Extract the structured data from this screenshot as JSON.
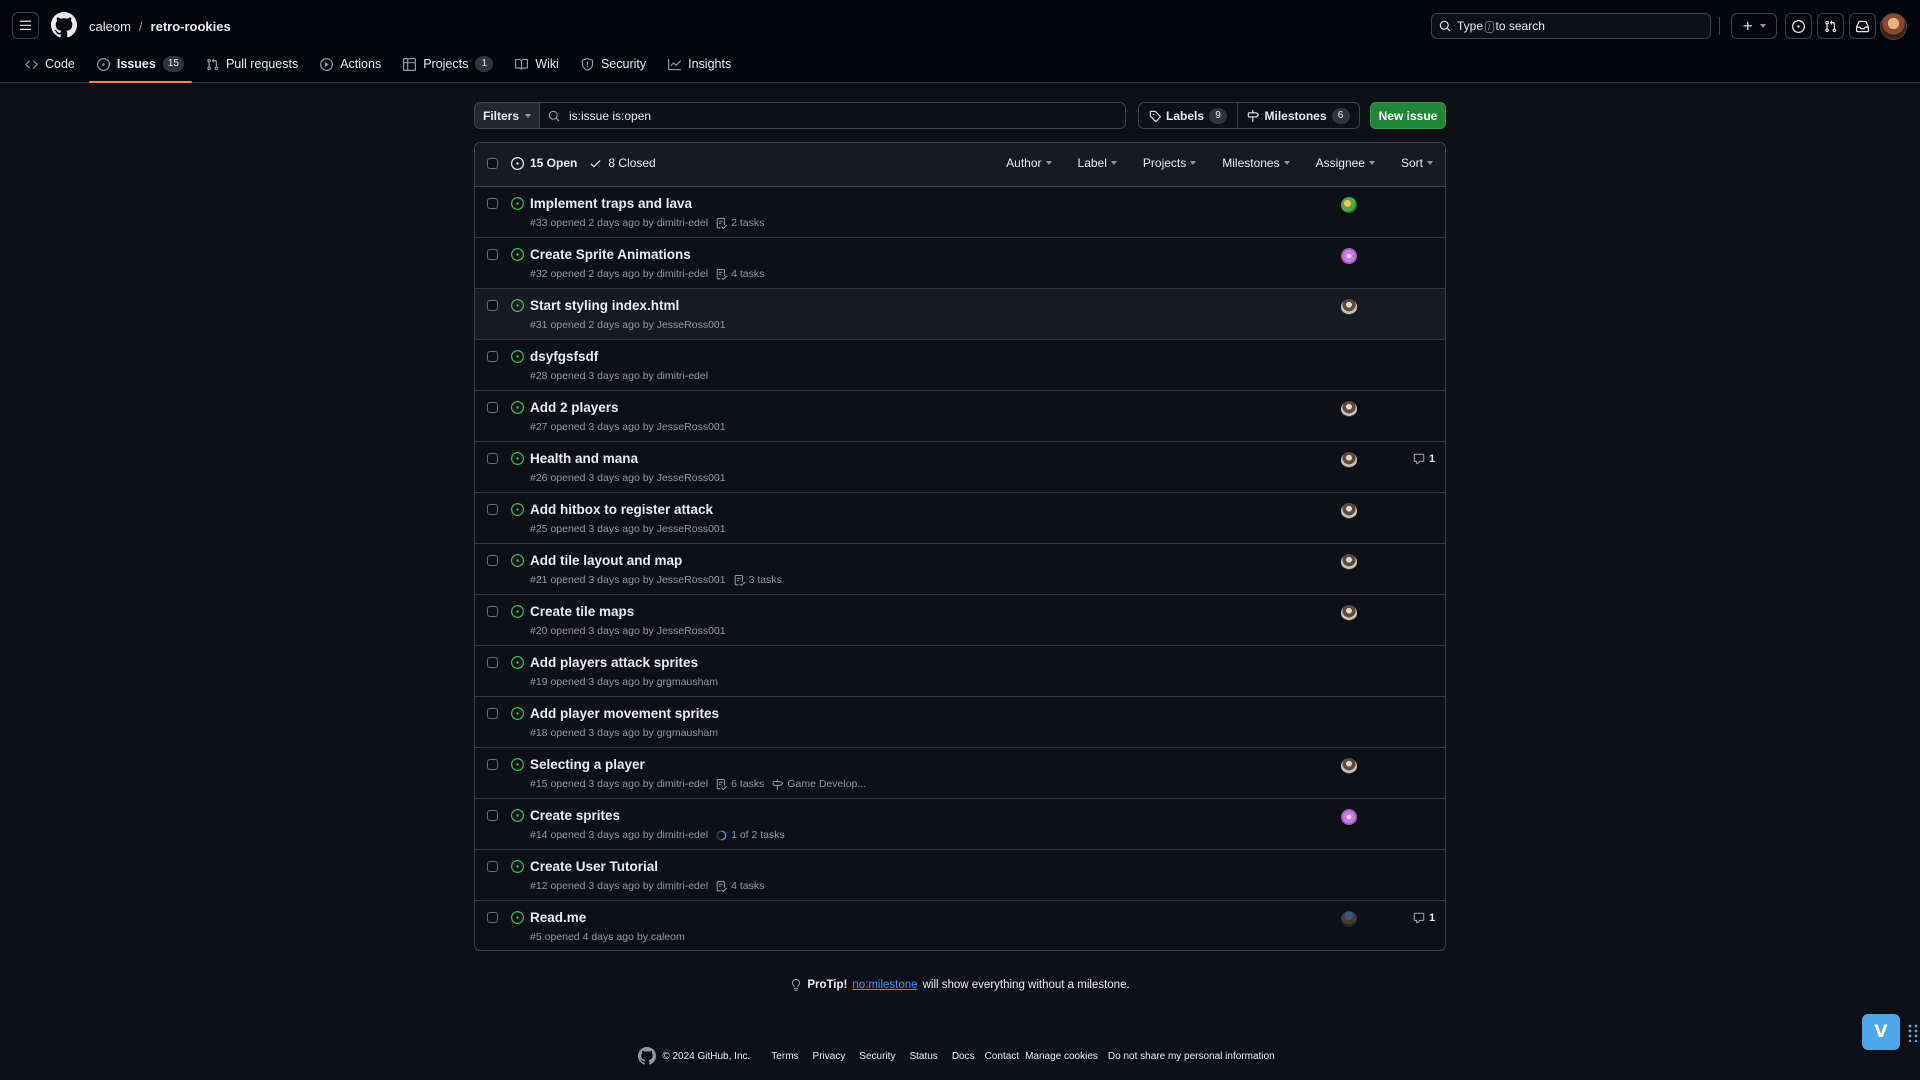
{
  "header": {
    "owner": "caleom",
    "separator": "/",
    "repo": "retro-rookies",
    "search_prefix": "Type",
    "search_key": "/",
    "search_suffix": "to search"
  },
  "repo_nav": [
    {
      "label": "Code",
      "icon": "code-icon"
    },
    {
      "label": "Issues",
      "icon": "issue-opened-icon",
      "count": "15",
      "selected": true
    },
    {
      "label": "Pull requests",
      "icon": "git-pull-request-icon"
    },
    {
      "label": "Actions",
      "icon": "play-icon"
    },
    {
      "label": "Projects",
      "icon": "table-icon",
      "count": "1"
    },
    {
      "label": "Wiki",
      "icon": "book-icon"
    },
    {
      "label": "Security",
      "icon": "shield-icon"
    },
    {
      "label": "Insights",
      "icon": "graph-icon"
    }
  ],
  "subnav": {
    "filters_label": "Filters",
    "query": "is:issue is:open",
    "labels_label": "Labels",
    "labels_count": "9",
    "milestones_label": "Milestones",
    "milestones_count": "6",
    "new_issue_label": "New issue"
  },
  "list_header": {
    "open_label": "15 Open",
    "closed_label": "8 Closed",
    "filters": [
      "Author",
      "Label",
      "Projects",
      "Milestones",
      "Assignee",
      "Sort"
    ]
  },
  "issues": [
    {
      "title": "Implement traps and lava",
      "number": "#33",
      "opened": "opened 2 days ago by",
      "author": "dimitri-edel",
      "tasks": "2 tasks",
      "task_icon": "checklist-icon",
      "assignee": "av-green"
    },
    {
      "title": "Create Sprite Animations",
      "number": "#32",
      "opened": "opened 2 days ago by",
      "author": "dimitri-edel",
      "tasks": "4 tasks",
      "task_icon": "checklist-icon",
      "assignee": "av-pink"
    },
    {
      "title": "Start styling index.html",
      "number": "#31",
      "opened": "opened 2 days ago by",
      "author": "JesseRoss001",
      "assignee": "av-gray",
      "highlight": true
    },
    {
      "title": "dsyfgsfsdf",
      "number": "#28",
      "opened": "opened 3 days ago by",
      "author": "dimitri-edel"
    },
    {
      "title": "Add 2 players",
      "number": "#27",
      "opened": "opened 3 days ago by",
      "author": "JesseRoss001",
      "assignee": "av-gray"
    },
    {
      "title": "Health and mana",
      "number": "#26",
      "opened": "opened 3 days ago by",
      "author": "JesseRoss001",
      "assignee": "av-gray",
      "comments": "1"
    },
    {
      "title": "Add hitbox to register attack",
      "number": "#25",
      "opened": "opened 3 days ago by",
      "author": "JesseRoss001",
      "assignee": "av-gray"
    },
    {
      "title": "Add tile layout and map",
      "number": "#21",
      "opened": "opened 3 days ago by",
      "author": "JesseRoss001",
      "tasks": "3 tasks",
      "task_icon": "checklist-icon",
      "assignee": "av-gray"
    },
    {
      "title": "Create tile maps",
      "number": "#20",
      "opened": "opened 3 days ago by",
      "author": "JesseRoss001",
      "assignee": "av-gray"
    },
    {
      "title": "Add players attack sprites",
      "number": "#19",
      "opened": "opened 3 days ago by",
      "author": "grgmausham"
    },
    {
      "title": "Add player movement sprites",
      "number": "#18",
      "opened": "opened 3 days ago by",
      "author": "grgmausham"
    },
    {
      "title": "Selecting a player",
      "number": "#15",
      "opened": "opened 3 days ago by",
      "author": "dimitri-edel",
      "tasks": "6 tasks",
      "task_icon": "checklist-icon",
      "milestone": "Game Develop...",
      "assignee": "av-gray"
    },
    {
      "title": "Create sprites",
      "number": "#14",
      "opened": "opened 3 days ago by",
      "author": "dimitri-edel",
      "tasks": "1 of 2 tasks",
      "task_icon": "progress-circle-icon",
      "assignee": "av-pink"
    },
    {
      "title": "Create User Tutorial",
      "number": "#12",
      "opened": "opened 3 days ago by",
      "author": "dimitri-edel",
      "tasks": "4 tasks",
      "task_icon": "checklist-icon"
    },
    {
      "title": "Read.me",
      "number": "#5",
      "opened": "opened 4 days ago by",
      "author": "caleom",
      "assignee": "av-blue",
      "comments": "1"
    }
  ],
  "protip": {
    "lead": "ProTip!",
    "link": "no:milestone",
    "rest": "will show everything without a milestone."
  },
  "footer": {
    "copyright": "© 2024 GitHub, Inc.",
    "links": [
      "Terms",
      "Privacy",
      "Security",
      "Status",
      "Docs",
      "Contact",
      "Manage cookies",
      "Do not share my personal information"
    ]
  },
  "chat_label": "V",
  "colors": {
    "open": "#3fb950",
    "accent_tab": "#f78166",
    "primary_button": "#238636",
    "link": "#4493f8"
  }
}
